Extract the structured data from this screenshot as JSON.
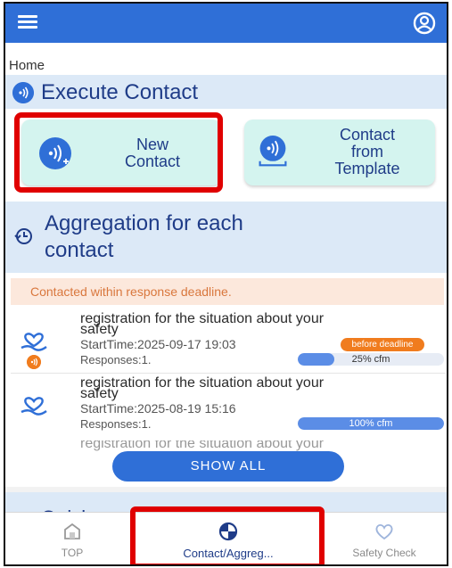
{
  "header": {
    "menu_icon": "hamburger-menu-icon",
    "account_icon": "account-circle-icon",
    "bar_color": "#2f6fd7"
  },
  "breadcrumb": {
    "home": "Home"
  },
  "execute_contact": {
    "title": "Execute Contact",
    "icon": "broadcast-icon",
    "new_contact": {
      "line1": "New",
      "line2": "Contact",
      "icon": "broadcast-add-icon"
    },
    "from_template": {
      "line1": "Contact",
      "line2": "from",
      "line3": "Template",
      "icon": "broadcast-template-icon"
    }
  },
  "aggregation": {
    "title_line1": "Aggregation for each",
    "title_line2": "contact",
    "icon": "history-icon",
    "notice": "Contacted within response deadline.",
    "items": [
      {
        "title_line1": "registration for the situation about your",
        "title_line2": "safety",
        "start": "StartTime:2025-09-17 19:03",
        "deadline_badge": "before deadline",
        "responses": "Responses:1.",
        "progress_label": "25% cfm",
        "progress_fraction": 0.25,
        "icon": "heart-hand-icon"
      },
      {
        "title_line1": "registration for the situation about your",
        "title_line2": "safety",
        "start": "StartTime:2025-08-19 15:16",
        "responses": "Responses:1.",
        "progress_label": "100% cfm",
        "progress_fraction": 1.0,
        "icon": "heart-hand-icon"
      },
      {
        "title_line1": "registration for the situation about your"
      }
    ],
    "show_all": "SHOW ALL"
  },
  "quick": {
    "title": "Quick menu"
  },
  "bottom_nav": {
    "top": {
      "label": "TOP",
      "icon": "home-icon"
    },
    "contact": {
      "label": "Contact/Aggreg...",
      "icon": "pie-chart-icon"
    },
    "safety": {
      "label": "Safety Check",
      "icon": "heart-icon"
    }
  },
  "colors": {
    "accent": "#2f6fd7",
    "card": "#d4f4ef",
    "section": "#dce9f7",
    "warning": "#f07c1e",
    "highlight": "#e00000"
  }
}
